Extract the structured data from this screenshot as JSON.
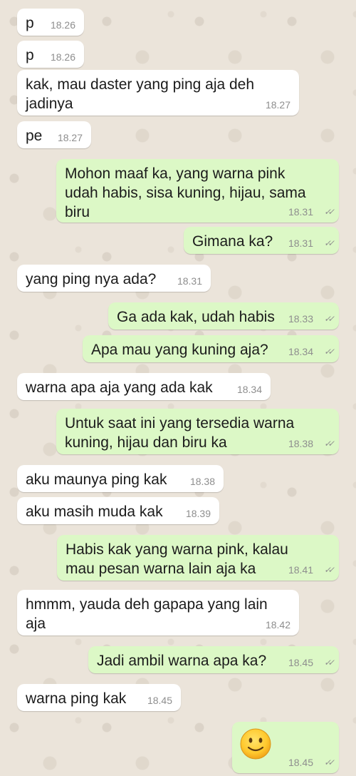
{
  "colors": {
    "incoming_bubble": "#ffffff",
    "outgoing_bubble": "#dcf8c6",
    "wallpaper": "#ebe4da",
    "timestamp": "#8e8e8e"
  },
  "messages": [
    {
      "dir": "in",
      "text": "p",
      "time": "18.26"
    },
    {
      "dir": "in",
      "text": "p",
      "time": "18.26"
    },
    {
      "dir": "in",
      "text": "kak, mau daster yang ping aja deh\njadinya",
      "time": "18.27"
    },
    {
      "dir": "in",
      "text": "pe",
      "time": "18.27"
    },
    {
      "dir": "out",
      "text": "Mohon maaf ka, yang warna pink\nudah habis, sisa kuning, hijau, sama\nbiru",
      "time": "18.31",
      "status": "read-ticks-icon"
    },
    {
      "dir": "out",
      "text": "Gimana ka?",
      "time": "18.31",
      "status": "read-ticks-icon"
    },
    {
      "dir": "in",
      "text": "yang ping nya ada?",
      "time": "18.31"
    },
    {
      "dir": "out",
      "text": "Ga ada kak, udah habis",
      "time": "18.33",
      "status": "read-ticks-icon"
    },
    {
      "dir": "out",
      "text": "Apa mau yang kuning aja?",
      "time": "18.34",
      "status": "read-ticks-icon"
    },
    {
      "dir": "in",
      "text": "warna apa aja yang ada kak",
      "time": "18.34"
    },
    {
      "dir": "out",
      "text": "Untuk saat ini yang tersedia warna\nkuning, hijau dan biru ka",
      "time": "18.38",
      "status": "read-ticks-icon"
    },
    {
      "dir": "in",
      "text": "aku maunya ping kak",
      "time": "18.38"
    },
    {
      "dir": "in",
      "text": "aku masih muda kak",
      "time": "18.39"
    },
    {
      "dir": "out",
      "text": "Habis kak yang warna pink, kalau\nmau pesan warna lain aja ka",
      "time": "18.41",
      "status": "read-ticks-icon"
    },
    {
      "dir": "in",
      "text": "hmmm, yauda deh gapapa yang lain\naja",
      "time": "18.42"
    },
    {
      "dir": "out",
      "text": "Jadi ambil warna apa ka?",
      "time": "18.45",
      "status": "read-ticks-icon"
    },
    {
      "dir": "in",
      "text": "warna ping kak",
      "time": "18.45"
    },
    {
      "dir": "out",
      "emoji": "slightly-smiling-face-icon",
      "time": "18.45",
      "status": "read-ticks-icon"
    }
  ]
}
